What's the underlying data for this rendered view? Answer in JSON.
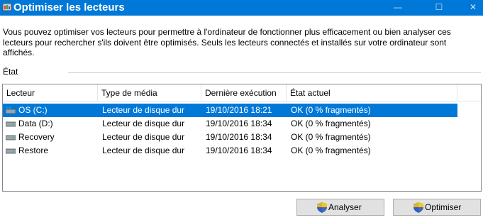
{
  "window": {
    "title": "Optimiser les lecteurs",
    "controls": {
      "minimize": "—",
      "maximize": "☐",
      "close": "✕"
    }
  },
  "description": "Vous pouvez optimiser vos lecteurs pour permettre à l'ordinateur de fonctionner plus efficacement ou bien analyser ces lecteurs pour rechercher s'ils doivent être optimisés. Seuls les lecteurs connectés et installés sur votre ordinateur sont affichés.",
  "status_section": {
    "label": "État"
  },
  "table": {
    "columns": [
      "Lecteur",
      "Type de média",
      "Dernière exécution",
      "État actuel"
    ],
    "rows": [
      {
        "drive": "OS (C:)",
        "media": "Lecteur de disque dur",
        "last_run": "19/10/2016 18:21",
        "state": "OK (0 % fragmentés)",
        "selected": true,
        "icon": "windows-drive-icon"
      },
      {
        "drive": "Data (D:)",
        "media": "Lecteur de disque dur",
        "last_run": "19/10/2016 18:34",
        "state": "OK (0 % fragmentés)",
        "selected": false,
        "icon": "drive-icon"
      },
      {
        "drive": "Recovery",
        "media": "Lecteur de disque dur",
        "last_run": "19/10/2016 18:34",
        "state": "OK (0 % fragmentés)",
        "selected": false,
        "icon": "drive-icon"
      },
      {
        "drive": "Restore",
        "media": "Lecteur de disque dur",
        "last_run": "19/10/2016 18:34",
        "state": "OK (0 % fragmentés)",
        "selected": false,
        "icon": "drive-icon"
      }
    ]
  },
  "buttons": {
    "analyze": "Analyser",
    "optimize": "Optimiser"
  },
  "colors": {
    "titlebar": "#0078d7",
    "selection": "#0078d7",
    "button_face": "#e1e1e1"
  }
}
